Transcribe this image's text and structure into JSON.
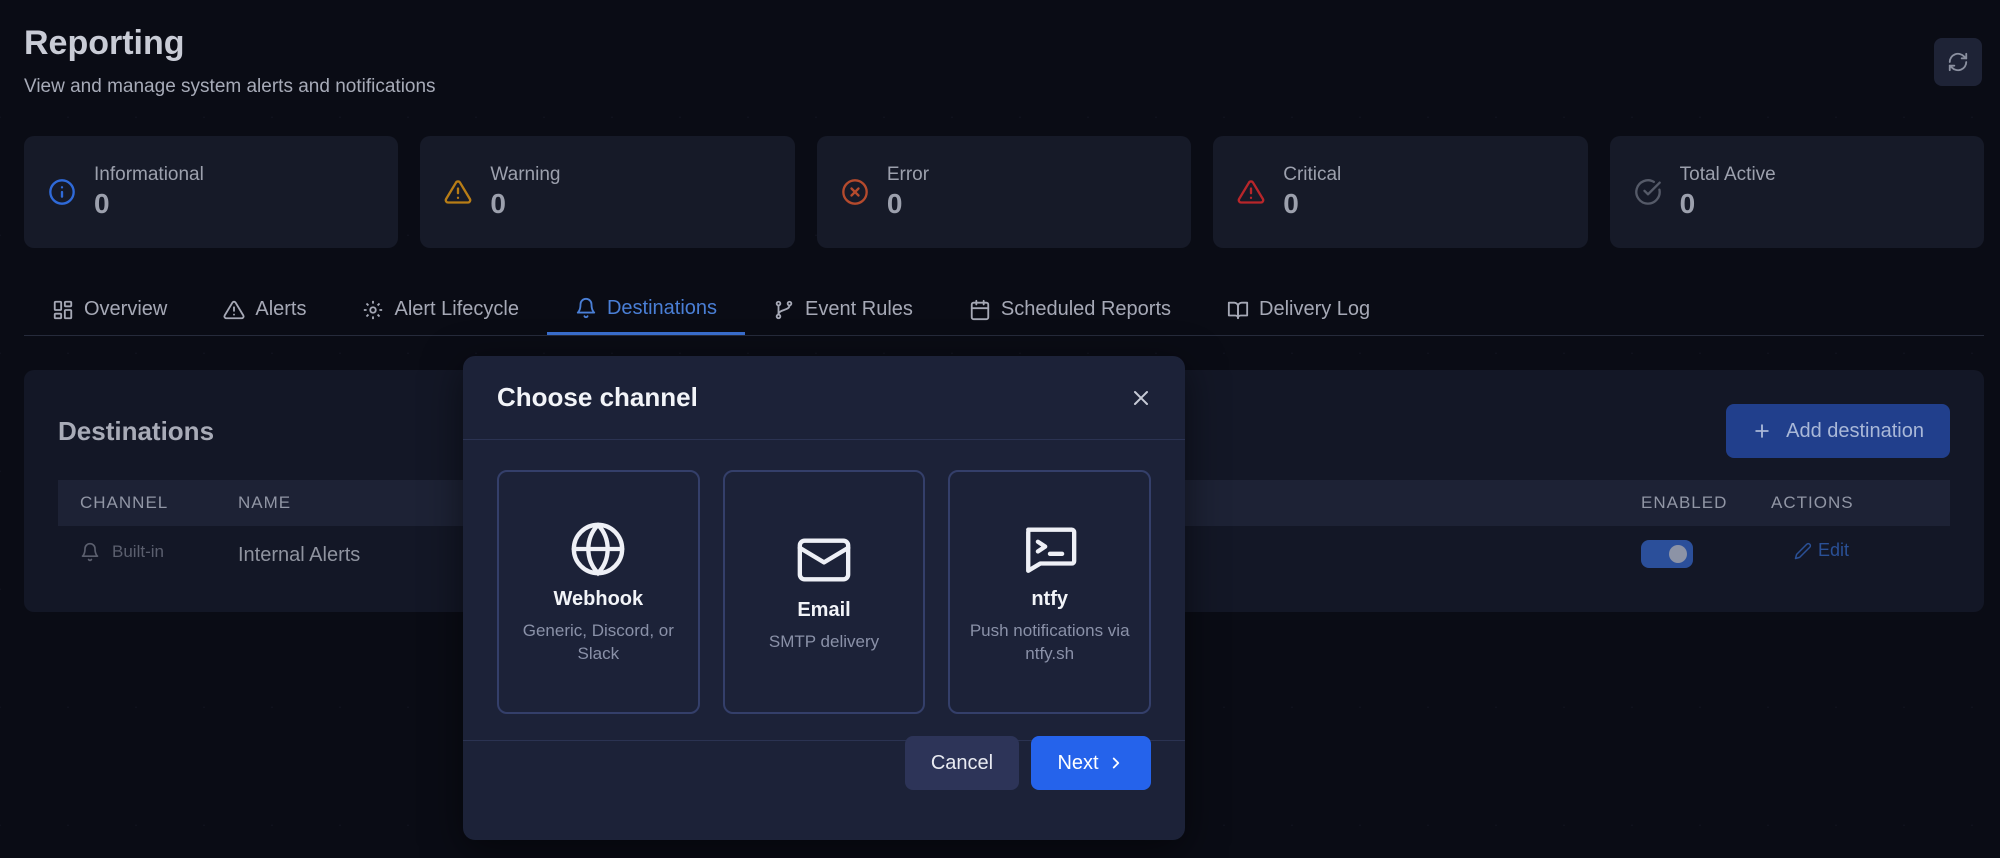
{
  "header": {
    "title": "Reporting",
    "subtitle": "View and manage system alerts and notifications",
    "refresh_icon": "refresh-icon"
  },
  "stats": [
    {
      "label": "Informational",
      "value": "0",
      "icon": "info-icon",
      "color": "#2f6ad9"
    },
    {
      "label": "Warning",
      "value": "0",
      "icon": "warning-icon",
      "color": "#b87d16"
    },
    {
      "label": "Error",
      "value": "0",
      "icon": "error-icon",
      "color": "#b44a2d"
    },
    {
      "label": "Critical",
      "value": "0",
      "icon": "critical-icon",
      "color": "#b8262a"
    },
    {
      "label": "Total Active",
      "value": "0",
      "icon": "check-circle-icon",
      "color": "#555a68"
    }
  ],
  "tabs": [
    {
      "label": "Overview",
      "icon": "grid-icon"
    },
    {
      "label": "Alerts",
      "icon": "triangle-icon"
    },
    {
      "label": "Alert Lifecycle",
      "icon": "gear-icon"
    },
    {
      "label": "Destinations",
      "icon": "bell-icon",
      "active": true
    },
    {
      "label": "Event Rules",
      "icon": "branch-icon"
    },
    {
      "label": "Scheduled Reports",
      "icon": "calendar-icon"
    },
    {
      "label": "Delivery Log",
      "icon": "book-icon"
    }
  ],
  "destinations": {
    "title": "Destinations",
    "add_label": "Add destination",
    "columns": {
      "channel": "CHANNEL",
      "name": "NAME",
      "enabled": "ENABLED",
      "actions": "ACTIONS"
    },
    "rows": [
      {
        "channel": "Built-in",
        "name": "Internal Alerts",
        "enabled": true,
        "action": "Edit"
      }
    ]
  },
  "modal": {
    "title": "Choose channel",
    "channels": [
      {
        "name": "Webhook",
        "description": "Generic, Discord, or Slack",
        "icon": "globe-icon"
      },
      {
        "name": "Email",
        "description": "SMTP delivery",
        "icon": "mail-icon"
      },
      {
        "name": "ntfy",
        "description": "Push notifications via ntfy.sh",
        "icon": "terminal-icon"
      }
    ],
    "cancel_label": "Cancel",
    "next_label": "Next"
  },
  "colors": {
    "accent": "#2563eb",
    "background": "#0a0c15",
    "active_tab": "#4a7fd6"
  }
}
